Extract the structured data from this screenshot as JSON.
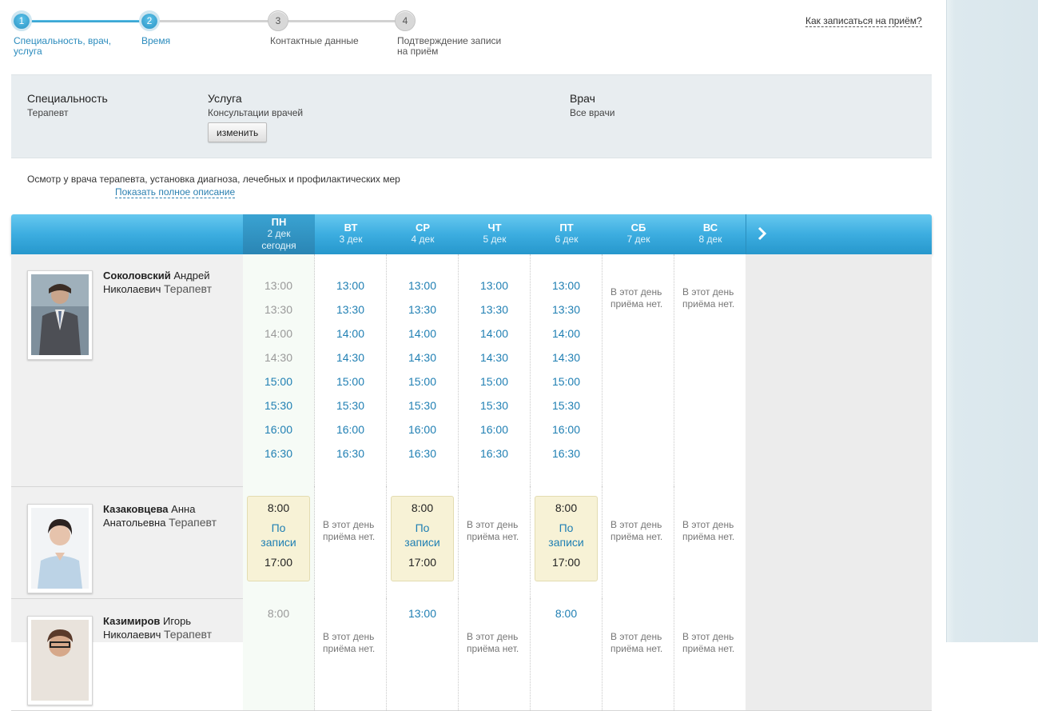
{
  "steps": [
    {
      "num": "1",
      "label": "Специальность, врач, услуга",
      "done": true
    },
    {
      "num": "2",
      "label": "Время",
      "done": true
    },
    {
      "num": "3",
      "label": "Контактные данные",
      "done": false
    },
    {
      "num": "4",
      "label": "Подтверждение записи на приём",
      "done": false
    }
  ],
  "help_link": "Как записаться на приём?",
  "summary": {
    "specialty_title": "Специальность",
    "specialty_value": "Терапевт",
    "service_title": "Услуга",
    "service_value": "Консультации врачей",
    "change_button": "изменить",
    "doctor_title": "Врач",
    "doctor_value": "Все врачи"
  },
  "description": "Осмотр у врача терапевта, установка диагноза, лечебных и профилактических мер",
  "description_link": "Показать полное описание",
  "days": [
    {
      "name": "ПН",
      "date": "2 дек",
      "note": "сегодня"
    },
    {
      "name": "ВТ",
      "date": "3 дек"
    },
    {
      "name": "СР",
      "date": "4 дек"
    },
    {
      "name": "ЧТ",
      "date": "5 дек"
    },
    {
      "name": "ПТ",
      "date": "6 дек"
    },
    {
      "name": "СБ",
      "date": "7 дек"
    },
    {
      "name": "ВС",
      "date": "8 дек"
    }
  ],
  "no_reception": "В этот день приёма нет.",
  "by_appointment": "По записи",
  "doctors": [
    {
      "surname": "Соколовский",
      "given": "Андрей Николаевич",
      "spec": "Терапевт",
      "schedule": [
        {
          "slots": [
            "13:00",
            "13:30",
            "14:00",
            "14:30",
            "15:00",
            "15:30",
            "16:00",
            "16:30"
          ],
          "past": 4
        },
        {
          "slots": [
            "13:00",
            "13:30",
            "14:00",
            "14:30",
            "15:00",
            "15:30",
            "16:00",
            "16:30"
          ]
        },
        {
          "slots": [
            "13:00",
            "13:30",
            "14:00",
            "14:30",
            "15:00",
            "15:30",
            "16:00",
            "16:30"
          ]
        },
        {
          "slots": [
            "13:00",
            "13:30",
            "14:00",
            "14:30",
            "15:00",
            "15:30",
            "16:00",
            "16:30"
          ]
        },
        {
          "slots": [
            "13:00",
            "13:30",
            "14:00",
            "14:30",
            "15:00",
            "15:30",
            "16:00",
            "16:30"
          ]
        },
        {
          "none": true
        },
        {
          "none": true
        }
      ]
    },
    {
      "surname": "Казаковцева",
      "given": "Анна Анатольевна",
      "spec": "Терапевт",
      "schedule": [
        {
          "queue": {
            "from": "8:00",
            "to": "17:00"
          }
        },
        {
          "none": true
        },
        {
          "queue": {
            "from": "8:00",
            "to": "17:00"
          }
        },
        {
          "none": true
        },
        {
          "queue": {
            "from": "8:00",
            "to": "17:00"
          }
        },
        {
          "none": true
        },
        {
          "none": true
        }
      ]
    },
    {
      "surname": "Казимиров",
      "given": "Игорь Николаевич",
      "spec": "Терапевт",
      "schedule": [
        {
          "slots": [
            "8:00"
          ],
          "past": 1
        },
        {
          "none": true
        },
        {
          "slots": [
            "13:00"
          ]
        },
        {
          "none": true
        },
        {
          "slots": [
            "8:00"
          ]
        },
        {
          "none": true
        },
        {
          "none": true
        }
      ]
    }
  ]
}
